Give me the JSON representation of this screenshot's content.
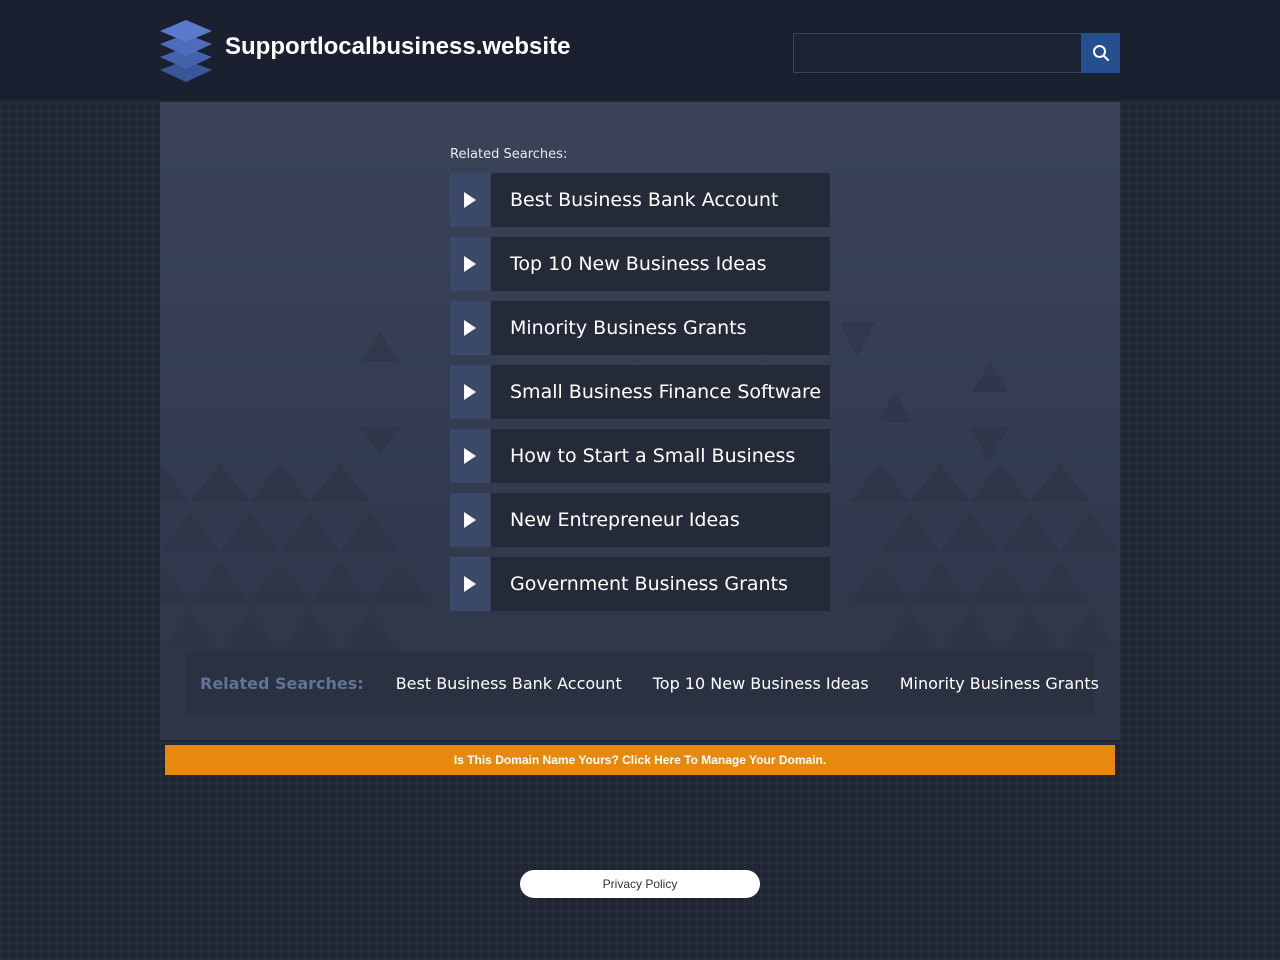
{
  "header": {
    "site_title": "Supportlocalbusiness.website",
    "search": {
      "value": "",
      "placeholder": ""
    },
    "logo_icon": "stacked-layers-icon",
    "search_icon": "search-icon"
  },
  "main": {
    "related_label": "Related Searches:",
    "links": [
      {
        "label": "Best Business Bank Account"
      },
      {
        "label": "Top 10 New Business Ideas"
      },
      {
        "label": "Minority Business Grants"
      },
      {
        "label": "Small Business Finance Software"
      },
      {
        "label": "How to Start a Small Business"
      },
      {
        "label": "New Entrepreneur Ideas"
      },
      {
        "label": "Government Business Grants"
      }
    ],
    "arrow_icon": "play-arrow-icon"
  },
  "bottom_bar": {
    "label": "Related Searches:",
    "links": [
      {
        "label": "Best Business Bank Account"
      },
      {
        "label": "Top 10 New Business Ideas"
      },
      {
        "label": "Minority Business Grants"
      }
    ]
  },
  "banner": {
    "text": "Is This Domain Name Yours? Click Here To Manage Your Domain."
  },
  "footer": {
    "privacy_label": "Privacy Policy"
  },
  "colors": {
    "header_bg": "#1a2030",
    "panel_bg": "#3a4358",
    "arrow_box": "#3b4867",
    "link_box": "#242a37",
    "search_button": "#264f8f",
    "banner": "#e8890f",
    "bottom_label": "#5f7496"
  }
}
